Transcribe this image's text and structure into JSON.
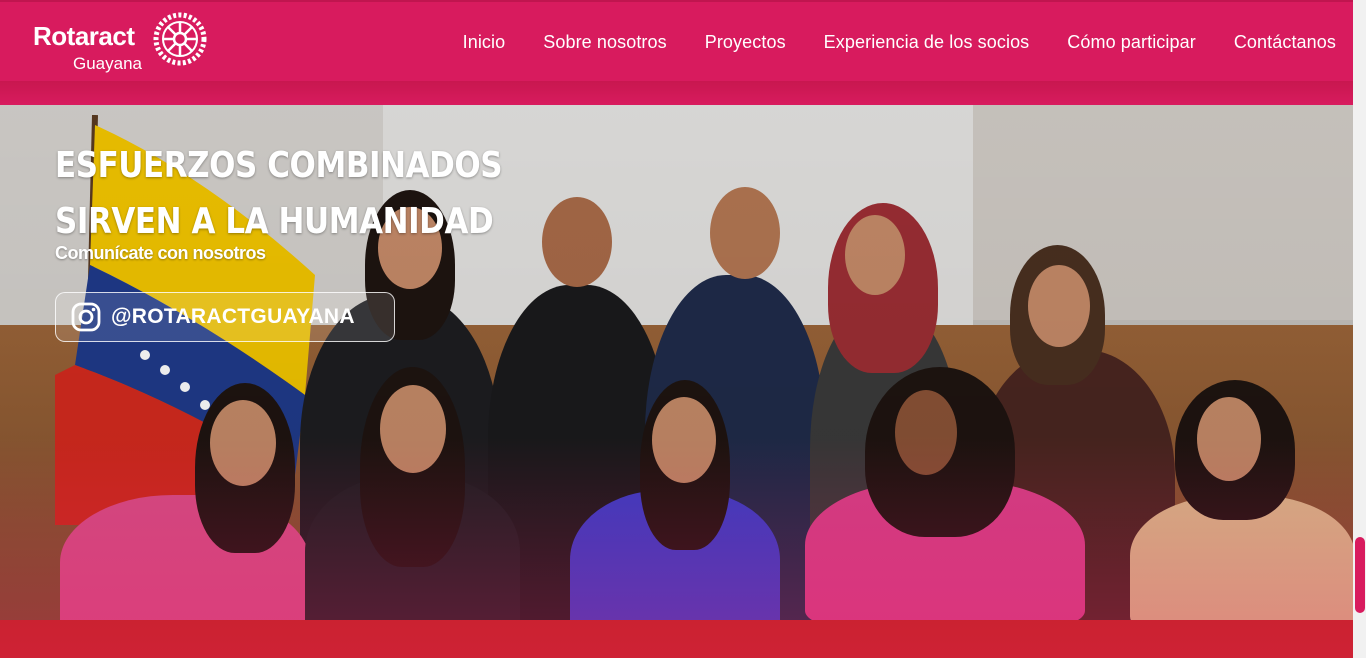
{
  "brand": {
    "name": "Rotaract",
    "subtitle": "Guayana",
    "primary_color": "#d81b5e",
    "emblem": "rotary-wheel-icon"
  },
  "nav": {
    "items": [
      {
        "label": "Inicio"
      },
      {
        "label": "Sobre nosotros"
      },
      {
        "label": "Proyectos"
      },
      {
        "label": "Experiencia de los socios"
      },
      {
        "label": "Cómo participar"
      },
      {
        "label": "Contáctanos"
      }
    ]
  },
  "hero": {
    "title_line1": "ESFUERZOS COMBINADOS",
    "title_line2": "SIRVEN A LA HUMANIDAD",
    "subtitle": "Comunícate con nosotros",
    "social": {
      "icon": "instagram-icon",
      "handle": "@ROTARACTGUAYANA"
    }
  }
}
